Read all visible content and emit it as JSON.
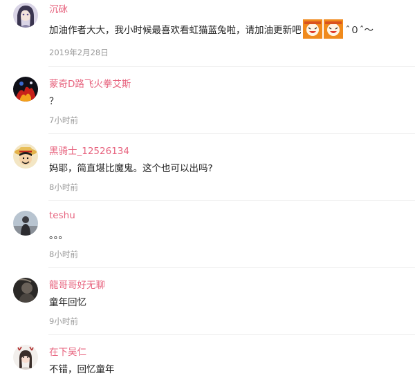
{
  "comments": [
    {
      "username": "沉砯",
      "content": "加油作者大大，我小时候最喜欢看虹猫蓝兔啦，请加油更新吧",
      "emoji_icons": [
        "laughing-face-sticker-icon",
        "laughing-face-sticker-icon"
      ],
      "kaomoji": "ˆ０ˆ～",
      "time": "2019年2月28日"
    },
    {
      "username": "蒙奇D路飞火拳艾斯",
      "content": "？",
      "time": "7小时前"
    },
    {
      "username": "黑骑士_12526134",
      "content": "妈耶，简直堪比魔鬼。这个也可以出吗?",
      "time": "8小时前"
    },
    {
      "username": "teshu",
      "content": "。。。",
      "time": "8小时前"
    },
    {
      "username": "龍哥哥好无聊",
      "content": "童年回忆",
      "time": "9小时前"
    },
    {
      "username": "在下吴仁",
      "content": "不错，回忆童年"
    }
  ],
  "colors": {
    "username": "#e7637e",
    "content": "#222222",
    "time": "#999999",
    "divider": "#eeeeee"
  }
}
